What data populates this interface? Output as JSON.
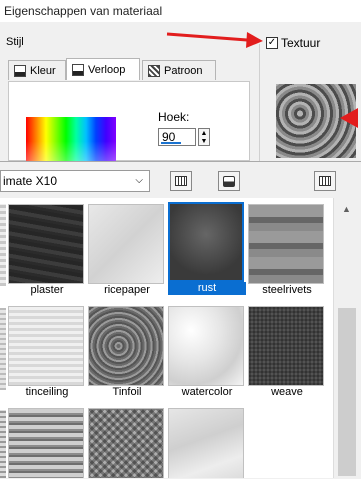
{
  "window": {
    "title": "Eigenschappen van materiaal"
  },
  "style_group": {
    "label": "Stijl",
    "tabs": [
      {
        "label": "Kleur",
        "icon": "palette-icon"
      },
      {
        "label": "Verloop",
        "icon": "gradient-icon"
      },
      {
        "label": "Patroon",
        "icon": "pattern-icon"
      }
    ],
    "active_tab": "Verloop",
    "angle_label": "Hoek:",
    "angle_value": "90"
  },
  "texture": {
    "checkbox_label": "Textuur",
    "checked": true,
    "check_mark": "✓"
  },
  "picker": {
    "category": "imate X10",
    "chevron": "⌵",
    "items": [
      {
        "label": "plaster",
        "texture": "plaster"
      },
      {
        "label": "ricepaper",
        "texture": "ricepaper"
      },
      {
        "label": "rust",
        "texture": "rust",
        "selected": true
      },
      {
        "label": "steelrivets",
        "texture": "steelrivets"
      },
      {
        "label": "tinceiling",
        "texture": "tinceiling"
      },
      {
        "label": "Tinfoil",
        "texture": "tinfoil"
      },
      {
        "label": "watercolor",
        "texture": "watercolor"
      },
      {
        "label": "weave",
        "texture": "weave"
      },
      {
        "label": "",
        "texture": "stripes"
      },
      {
        "label": "",
        "texture": "basket"
      },
      {
        "label": "",
        "texture": "marble"
      }
    ]
  },
  "colors": {
    "selection": "#0a6ed1",
    "arrow": "#e21d1d"
  }
}
